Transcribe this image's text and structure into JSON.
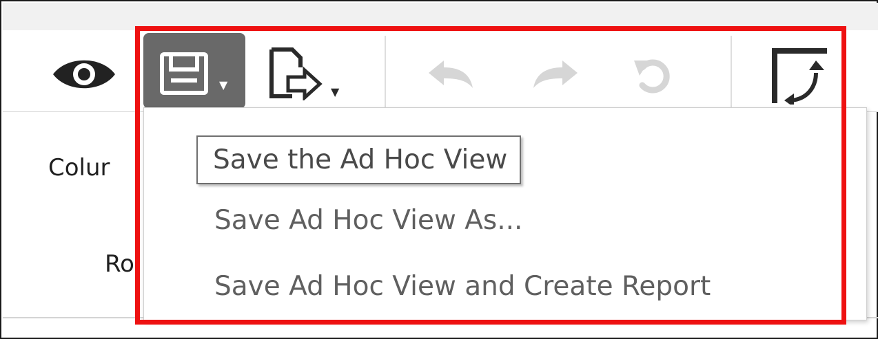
{
  "toolbar": {
    "icons": [
      "eye-icon",
      "save-icon",
      "export-icon",
      "undo-icon",
      "redo-icon",
      "undo-all-icon",
      "switch-axes-icon"
    ],
    "dropdown_arrow": "▼"
  },
  "left_panel": {
    "columns_label_partial": "Colur",
    "rows_label_partial": "Ro"
  },
  "save_menu": {
    "items": [
      {
        "label": "Save the Ad Hoc View"
      },
      {
        "label": "Save Ad Hoc View As..."
      },
      {
        "label": "Save Ad Hoc View and Create Report"
      }
    ]
  },
  "colors": {
    "highlight": "#ee1111",
    "active_button": "#696969",
    "menu_text": "#5f5f5f",
    "disabled_icon": "#d6d6d6"
  }
}
